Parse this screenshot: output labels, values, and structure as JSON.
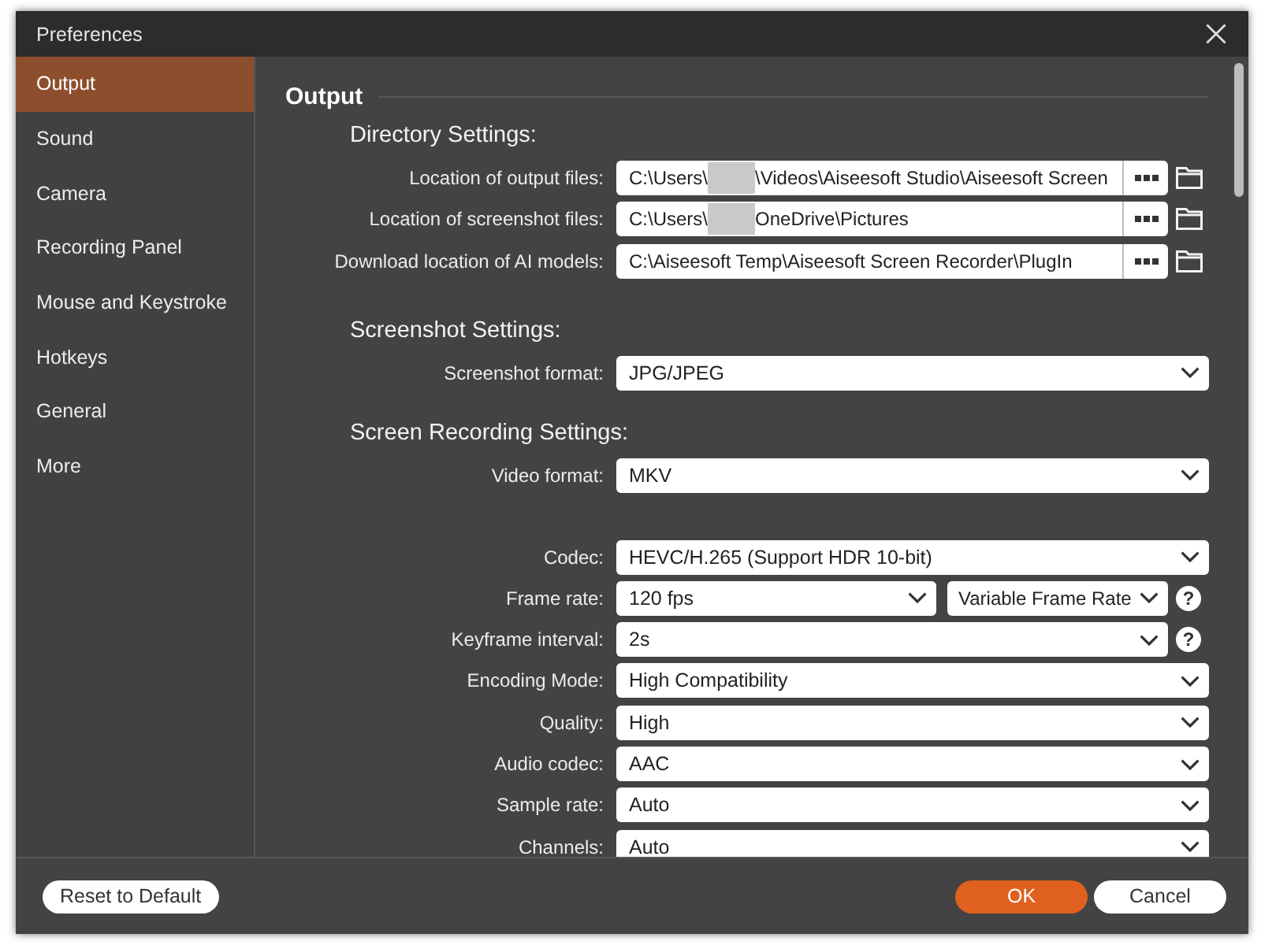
{
  "window": {
    "title": "Preferences"
  },
  "sidebar": {
    "items": [
      {
        "label": "Output",
        "selected": true
      },
      {
        "label": "Sound",
        "selected": false
      },
      {
        "label": "Camera",
        "selected": false
      },
      {
        "label": "Recording Panel",
        "selected": false
      },
      {
        "label": "Mouse and Keystroke",
        "selected": false
      },
      {
        "label": "Hotkeys",
        "selected": false
      },
      {
        "label": "General",
        "selected": false
      },
      {
        "label": "More",
        "selected": false
      }
    ]
  },
  "content": {
    "heading": "Output",
    "sections": [
      {
        "title": "Directory Settings:",
        "groups": [
          [
            {
              "kind": "path",
              "label": "Location of output files:",
              "value": "C:\\Users\\",
              "redacted": true,
              "value_after": "\\Videos\\Aiseesoft Studio\\Aiseesoft Screen"
            },
            {
              "kind": "path",
              "label": "Location of screenshot files:",
              "value": "C:\\Users\\",
              "redacted": true,
              "value_after": "OneDrive\\Pictures"
            },
            {
              "kind": "path",
              "label": "Download location of AI models:",
              "value": "C:\\Aiseesoft Temp\\Aiseesoft Screen Recorder\\PlugIn"
            }
          ]
        ]
      },
      {
        "title": "Screenshot Settings:",
        "groups": [
          [
            {
              "kind": "select",
              "label": "Screenshot format:",
              "values": [
                "JPG/JPEG"
              ]
            }
          ]
        ]
      },
      {
        "title": "Screen Recording Settings:",
        "groups": [
          [
            {
              "kind": "select",
              "label": "Video format:",
              "values": [
                "MKV"
              ]
            }
          ],
          [
            {
              "kind": "select",
              "label": "Codec:",
              "values": [
                "HEVC/H.265 (Support HDR 10-bit)"
              ]
            },
            {
              "kind": "select",
              "label": "Frame rate:",
              "values": [
                "120 fps",
                "Variable Frame Rate"
              ],
              "help": "?"
            },
            {
              "kind": "select",
              "label": "Keyframe interval:",
              "values": [
                "2s"
              ],
              "help": "?"
            },
            {
              "kind": "select",
              "label": "Encoding Mode:",
              "values": [
                "High Compatibility"
              ]
            },
            {
              "kind": "select",
              "label": "Quality:",
              "values": [
                "High"
              ]
            },
            {
              "kind": "select",
              "label": "Audio codec:",
              "values": [
                "AAC"
              ]
            },
            {
              "kind": "select",
              "label": "Sample rate:",
              "values": [
                "Auto"
              ]
            },
            {
              "kind": "select",
              "label": "Channels:",
              "values": [
                "Auto"
              ]
            }
          ]
        ]
      }
    ]
  },
  "footer": {
    "left_buttons": [
      {
        "label": "Reset to Default",
        "kind": "secondary"
      }
    ],
    "right_buttons": [
      {
        "label": "OK",
        "kind": "primary"
      },
      {
        "label": "Cancel",
        "kind": "secondary"
      }
    ]
  }
}
